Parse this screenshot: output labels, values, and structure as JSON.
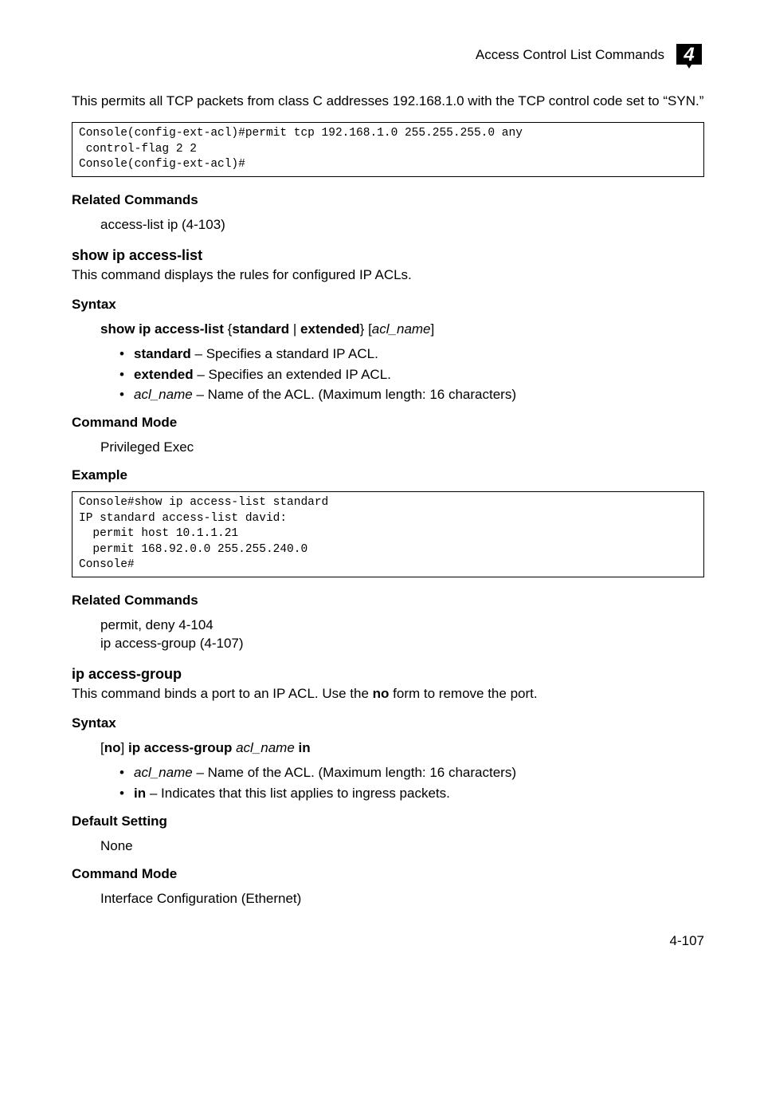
{
  "header": {
    "section_title": "Access Control List Commands",
    "chapter_number": "4"
  },
  "intro_paragraph_pre": "This permits all TCP packets from class C addresses 192.168.1.0 with the TCP control code set to ",
  "intro_paragraph_quote": "“SYN.”",
  "code1": "Console(config-ext-acl)#permit tcp 192.168.1.0 255.255.255.0 any\n control-flag 2 2\nConsole(config-ext-acl)#",
  "labels": {
    "related_commands": "Related Commands",
    "syntax": "Syntax",
    "command_mode": "Command Mode",
    "example": "Example",
    "default_setting": "Default Setting"
  },
  "rc1": "access-list ip (4-103)",
  "show_ip": {
    "title": "show ip access-list",
    "desc": "This command displays the rules for configured IP ACLs.",
    "syntax_cmd_b1": "show ip access-list",
    "syntax_brace_open": " {",
    "syntax_b2": "standard",
    "syntax_pipe": " | ",
    "syntax_b3": "extended",
    "syntax_brace_close": "} [",
    "syntax_i1": "acl_name",
    "syntax_close2": "]",
    "bullets": {
      "b1_b": "standard",
      "b1_t": " – Specifies a standard IP ACL.",
      "b2_b": "extended",
      "b2_t": " – Specifies an extended IP ACL.",
      "b3_i": "acl_name",
      "b3_t": " – Name of the ACL. (Maximum length: 16 characters)"
    },
    "cmd_mode": "Privileged Exec"
  },
  "code2": "Console#show ip access-list standard\nIP standard access-list david:\n  permit host 10.1.1.21\n  permit 168.92.0.0 255.255.240.0\nConsole#",
  "rc2_line1": "permit, deny 4-104",
  "rc2_line2": "ip access-group (4-107)",
  "ip_ag": {
    "title": "ip access-group",
    "desc_pre": "This command binds a port to an IP ACL. Use the ",
    "desc_bold": "no",
    "desc_post": " form to remove the port.",
    "syntax_open": "[",
    "syntax_no": "no",
    "syntax_mid": "] ",
    "syntax_cmd": "ip access-group",
    "syntax_space": " ",
    "syntax_acl": "acl_name",
    "syntax_space2": " ",
    "syntax_in": "in",
    "bullets": {
      "b1_i": "acl_name",
      "b1_t": " – Name of the ACL. (Maximum length: 16 characters)",
      "b2_b": "in",
      "b2_t": " – Indicates that this list applies to ingress packets."
    },
    "default": "None",
    "cmd_mode": "Interface Configuration (Ethernet)"
  },
  "page_number": "4-107"
}
